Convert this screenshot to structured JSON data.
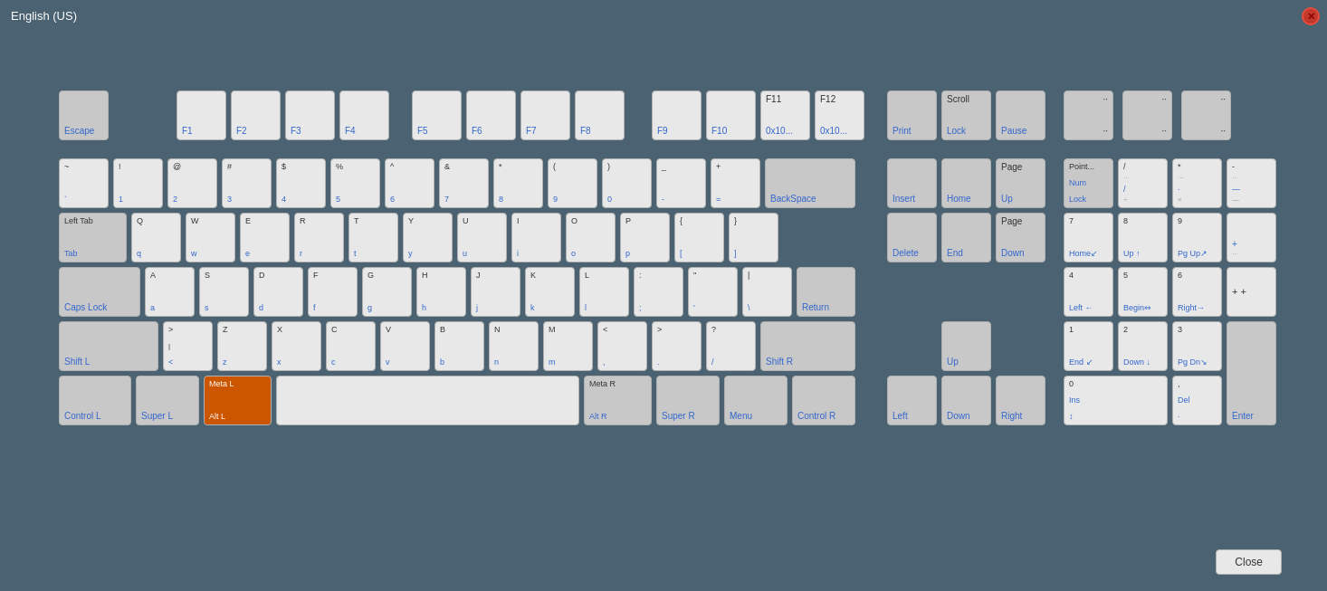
{
  "title": "English (US)",
  "close_label": "Close",
  "keys": {
    "escape": "Escape",
    "f1": "F1",
    "f2": "F2",
    "f3": "F3",
    "f4": "F4",
    "f5": "F5",
    "f6": "F6",
    "f7": "F7",
    "f8": "F8",
    "f9": "F9",
    "f10": "F10",
    "f11": "F11\n0x10...",
    "f12": "F12\n0x10...",
    "print": "Print",
    "scroll_lock": "Scroll\nLock",
    "pause": "Pause",
    "backtick": "~\n`",
    "1": "!\n1",
    "2": "@\n2",
    "3": "#\n3",
    "4": "$\n4",
    "5": "%\n5",
    "6": "^\n6",
    "7": "&\n7",
    "8": "*\n8",
    "9": "(\n9",
    "0": ")\n0",
    "minus": "-\n-",
    "equals": "+\n=",
    "backspace": "BackSpace",
    "insert": "Insert",
    "home": "Home",
    "page_up": "Page\nUp",
    "tab": "Left Tab\nTab",
    "q": "Q\nq",
    "w": "W\nw",
    "e": "E\ne",
    "r": "R\nr",
    "t": "T\nt",
    "y": "Y\ny",
    "u": "U\nu",
    "i": "I\ni",
    "o": "O\no",
    "p": "P\np",
    "bracket_open": "{\n[",
    "bracket_close": "}\n]",
    "delete": "Delete",
    "end": "End",
    "page_down": "Page\nDown",
    "caps_lock": "Caps Lock",
    "a": "A\na",
    "s": "S\ns",
    "d": "D\nd",
    "f": "F\nf",
    "g": "G\ng",
    "h": "H\nh",
    "j": "J\nj",
    "k": "K\nk",
    "l": "L\nl",
    "semicolon": ":\n;",
    "quote": "\"\n'",
    "backslash": "|\n\\",
    "return": "Return",
    "shift_l": "Shift L",
    "angle": ">\n<\n|\n<",
    "z": "Z\nz",
    "x": "X\nx",
    "c": "C\nc",
    "v": "V\nv",
    "b": "B\nb",
    "n": "N\nn",
    "m": "M\nm",
    "comma": "<\n,",
    "period": ">\n.",
    "slash": "?\n/",
    "shift_r": "Shift R",
    "up": "Up",
    "control_l": "Control L",
    "super_l": "Super L",
    "meta_l": "Meta L\nAlt L",
    "space": "",
    "meta_r": "Meta R\nAlt R",
    "super_r": "Super R",
    "menu": "Menu",
    "control_r": "Control R",
    "left": "Left",
    "down": "Down",
    "right": "Right",
    "numlock": "Point...\nNum\nLock",
    "num_slash": "/\n/",
    "num_asterisk": "*\n*",
    "num_minus": "-\n-",
    "num7": "7\nHome",
    "num8": "8\nUp ↑",
    "num9": "9\nPg Up",
    "num_plus_top": "+\n...",
    "num4": "4\nLeft ←",
    "num5": "5\nBegin",
    "num6": "6\nRight →",
    "num_plus_bottom": "+ +",
    "num1": "1\nEnd ↙",
    "num2": "2\nDown ↓",
    "num3": "3\nPg Dn",
    "num_enter": "Enter",
    "num0": "0\nIns",
    "num_decimal": ",\nDel"
  }
}
